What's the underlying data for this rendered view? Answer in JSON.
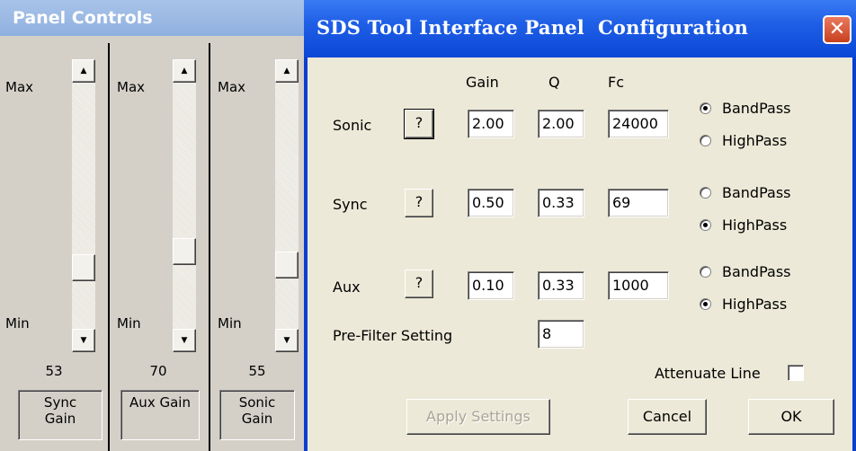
{
  "left_panel": {
    "title": "Panel Controls",
    "strips": [
      {
        "max_label": "Max",
        "min_label": "Min",
        "value": "53",
        "name": "Sync\nGain",
        "level": 53
      },
      {
        "max_label": "Max",
        "min_label": "Min",
        "value": "70",
        "name": "Aux Gain",
        "level": 70
      },
      {
        "max_label": "Max",
        "min_label": "Min",
        "value": "55",
        "name": "Sonic\nGain",
        "level": 55
      }
    ]
  },
  "dialog": {
    "title": "SDS Tool Interface Panel  Configuration",
    "close_glyph": "✕",
    "headers": {
      "gain": "Gain",
      "q": "Q",
      "fc": "Fc"
    },
    "rows": [
      {
        "label": "Sonic",
        "help": "?",
        "gain": "2.00",
        "q": "2.00",
        "fc": "24000",
        "bandpass_label": "BandPass",
        "highpass_label": "HighPass",
        "selected": "BandPass"
      },
      {
        "label": "Sync",
        "help": "?",
        "gain": "0.50",
        "q": "0.33",
        "fc": "69",
        "bandpass_label": "BandPass",
        "highpass_label": "HighPass",
        "selected": "HighPass"
      },
      {
        "label": "Aux",
        "help": "?",
        "gain": "0.10",
        "q": "0.33",
        "fc": "1000",
        "bandpass_label": "BandPass",
        "highpass_label": "HighPass",
        "selected": "HighPass"
      }
    ],
    "prefilter": {
      "label": "Pre-Filter Setting",
      "value": "8"
    },
    "attenuate": {
      "label": "Attenuate Line",
      "checked": false
    },
    "buttons": {
      "apply": "Apply Settings",
      "cancel": "Cancel",
      "ok": "OK"
    }
  },
  "colors": {
    "titlebar": "#0b47d6",
    "panel_title": "#8fb0df",
    "face": "#ece9d8"
  },
  "icons": {
    "scroll_up": "up-arrow-icon",
    "scroll_down": "down-arrow-icon",
    "close": "close-icon",
    "help": "question-icon"
  }
}
